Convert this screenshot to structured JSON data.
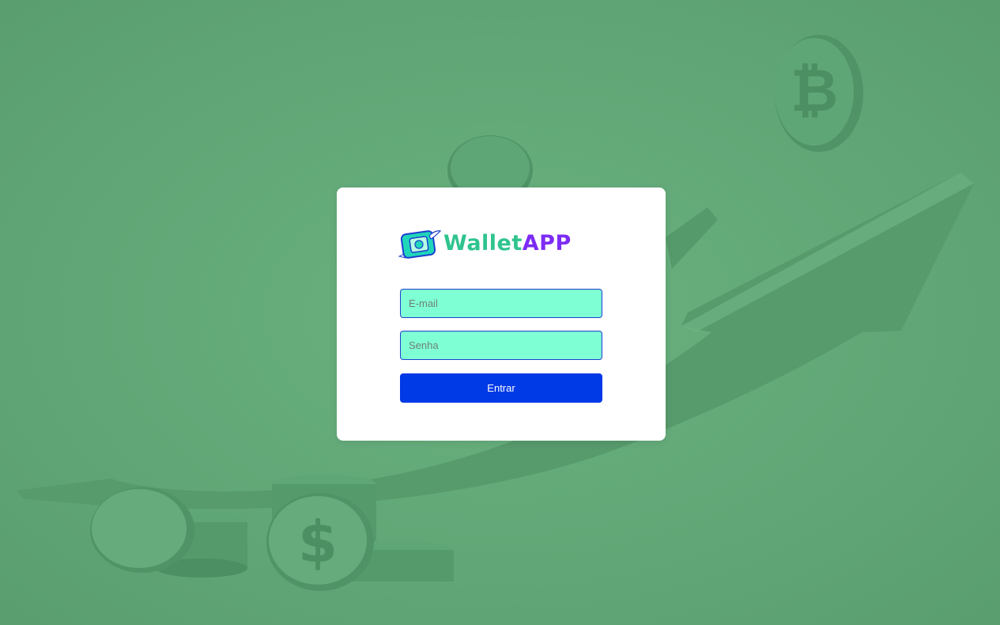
{
  "brand": {
    "name_part1": "Wallet",
    "name_part2": "APP",
    "primary_color": "#2fc48e",
    "accent_color": "#7c2cf5"
  },
  "background": {
    "color": "#62a878",
    "coin_symbols": [
      "₿",
      "$"
    ]
  },
  "login": {
    "email_placeholder": "E-mail",
    "email_value": "",
    "password_placeholder": "Senha",
    "password_value": "",
    "submit_label": "Entrar",
    "field_background": "#7fffd4",
    "button_color": "#0039e6"
  }
}
